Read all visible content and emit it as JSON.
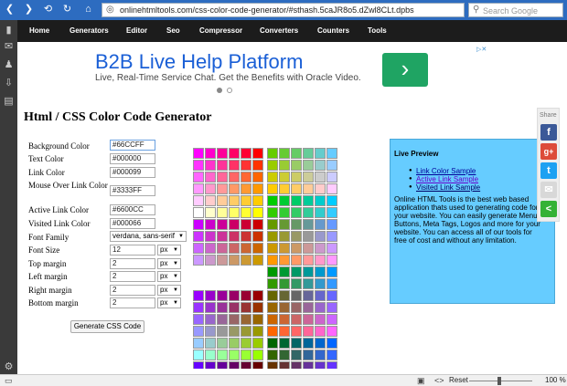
{
  "browser": {
    "url": "onlinehtmltools.com/css-color-code-generator/#sthash.5caJR8o5.dZwl8CLt.dpbs",
    "search_placeholder": "Search Google",
    "icons": [
      "back-arrow-icon",
      "forward-arrow-icon",
      "refresh-icon",
      "reload-icon",
      "home-icon"
    ]
  },
  "sidebar_icons": [
    "bookmark-icon",
    "mail-icon",
    "contacts-icon",
    "download-icon",
    "notes-icon",
    "settings-icon"
  ],
  "nav": [
    "Home",
    "Generators",
    "Editor",
    "Seo",
    "Compressor",
    "Converters",
    "Counters",
    "Tools"
  ],
  "ad": {
    "title": "B2B Live Help Platform",
    "text": "Live, Real-Time Service Chat. Get the Benefits with Oracle Video.",
    "arrow": "›",
    "badge": "▷✕"
  },
  "page_title": "Html / CSS Color Code Generator",
  "form": {
    "fields": [
      {
        "label": "Background Color",
        "value": "#66CCFF"
      },
      {
        "label": "Text Color",
        "value": "#000000"
      },
      {
        "label": "Link Color",
        "value": "#000099"
      },
      {
        "label": "Mouse Over Link Color",
        "value": "#3333FF"
      },
      {
        "label": "Active Link Color",
        "value": "#6600CC"
      },
      {
        "label": "Visited Link Color",
        "value": "#000066"
      }
    ],
    "font_family": {
      "label": "Font Family",
      "value": "verdana, sans-serif"
    },
    "sized": [
      {
        "label": "Font Size",
        "value": "12",
        "unit": "px"
      },
      {
        "label": "Top margin",
        "value": "2",
        "unit": "px"
      },
      {
        "label": "Left margin",
        "value": "2",
        "unit": "px"
      },
      {
        "label": "Right margin",
        "value": "2",
        "unit": "px"
      },
      {
        "label": "Bottom margin",
        "value": "2",
        "unit": "px"
      }
    ],
    "button": "Generate CSS Code"
  },
  "preview": {
    "title": "Live Preview",
    "links": [
      "Link Color Sample",
      "Active Link Sample",
      "Visited Link Sample"
    ],
    "text": "Online HTML Tools is the best web based application thats used to generating code for your website. You can easily generate Menu, Buttons, Meta Tags, Logos and more for your website. You can access all of our tools for free of cost and without any limitation."
  },
  "share": {
    "label": "Share",
    "buttons": [
      {
        "name": "facebook-icon",
        "glyph": "f",
        "color": "#3b5998"
      },
      {
        "name": "google-plus-icon",
        "glyph": "g+",
        "color": "#dd4b39"
      },
      {
        "name": "twitter-icon",
        "glyph": "t",
        "color": "#1da1f2"
      },
      {
        "name": "email-icon",
        "glyph": "✉",
        "color": "#d8d8d8"
      },
      {
        "name": "sharethis-icon",
        "glyph": "<",
        "color": "#35b236"
      }
    ]
  },
  "status": {
    "reset": "Reset",
    "zoom": "100 %"
  },
  "colors": {
    "accent": "#2d6cc0",
    "nav_bg": "#1c1c1c",
    "preview_bg": "#66ccff",
    "link": "#000099",
    "active_link": "#6600cc",
    "visited_link": "#000066"
  }
}
